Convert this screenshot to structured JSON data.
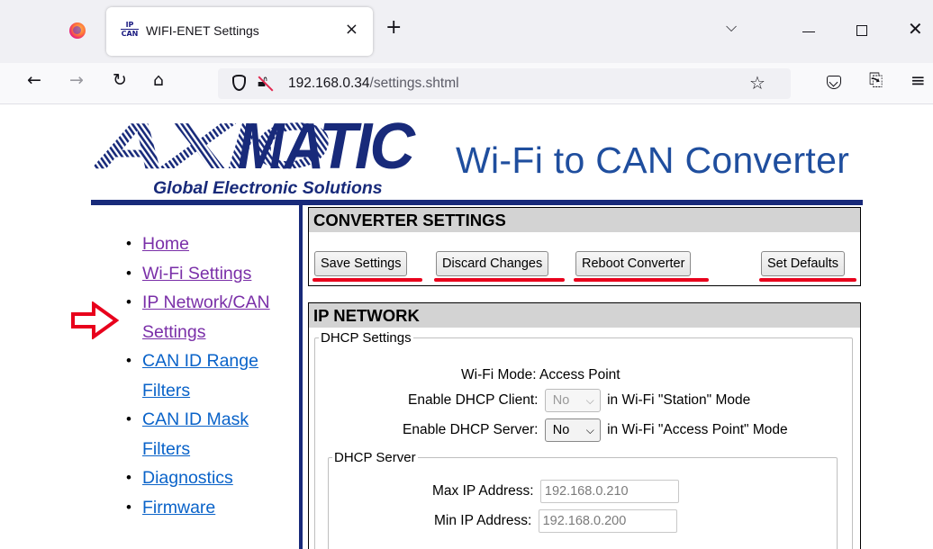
{
  "browser": {
    "tab_title": "WIFI-ENET Settings",
    "tab_favicon_top": "IP",
    "tab_favicon_bottom": "CAN",
    "tab_close": "×",
    "new_tab": "+",
    "url_host": "192.168.0.34",
    "url_path": "/settings.shtml"
  },
  "header": {
    "logo_text": "AXIOMATIC",
    "logo_tagline": "Global Electronic Solutions",
    "title": "Wi-Fi to CAN Converter"
  },
  "sidebar": {
    "items": [
      {
        "label": "Home"
      },
      {
        "label": "Wi-Fi Settings"
      },
      {
        "label": "IP Network/CAN Settings"
      },
      {
        "label": "CAN ID Range Filters"
      },
      {
        "label": "CAN ID Mask Filters"
      },
      {
        "label": "Diagnostics"
      },
      {
        "label": "Firmware"
      }
    ]
  },
  "converter_settings": {
    "title": "CONVERTER SETTINGS",
    "buttons": {
      "save": "Save Settings",
      "discard": "Discard Changes",
      "reboot": "Reboot Converter",
      "defaults": "Set Defaults"
    }
  },
  "ip_network": {
    "title": "IP NETWORK",
    "dhcp_settings": {
      "legend": "DHCP Settings",
      "wifi_mode_label": "Wi-Fi Mode:",
      "wifi_mode_value": "Access Point",
      "client_label": "Enable DHCP Client:",
      "client_value": "No",
      "client_suffix": "in Wi-Fi \"Station\" Mode",
      "server_label": "Enable DHCP Server:",
      "server_value": "No",
      "server_suffix": "in Wi-Fi \"Access Point\" Mode"
    },
    "dhcp_server": {
      "legend": "DHCP Server",
      "max_label": "Max IP Address:",
      "max_value": "192.168.0.210",
      "min_label": "Min IP Address:",
      "min_value": "192.168.0.200"
    }
  },
  "colors": {
    "accent_blue": "#1f4e9e",
    "rule_navy": "#182a7a",
    "highlight_red": "#e8001c",
    "link": "#0a63c9",
    "visited_link": "#7a2fa8"
  }
}
